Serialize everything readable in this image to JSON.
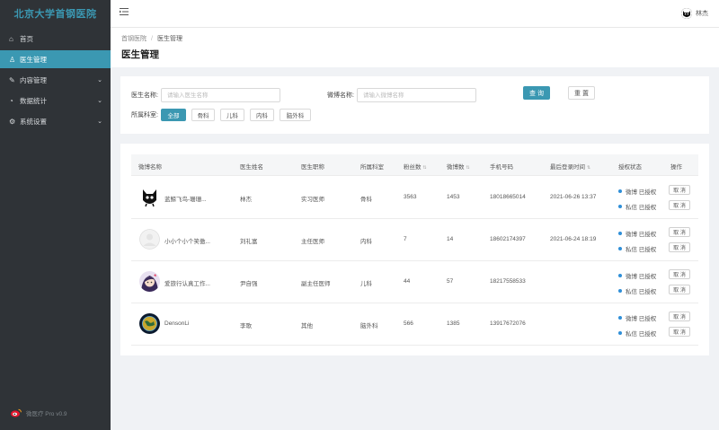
{
  "sidebar": {
    "brand": "北京大学首钢医院",
    "items": [
      {
        "label": "首页",
        "icon": "home-icon",
        "glyph": "⌂",
        "has_children": false,
        "active": false
      },
      {
        "label": "医生管理",
        "icon": "user-icon",
        "glyph": "♙",
        "has_children": false,
        "active": true
      },
      {
        "label": "内容管理",
        "icon": "edit-icon",
        "glyph": "✎",
        "has_children": true,
        "active": false
      },
      {
        "label": "数据统计",
        "icon": "pie-chart-icon",
        "glyph": "◔",
        "has_children": true,
        "active": false
      },
      {
        "label": "系统设置",
        "icon": "gear-icon",
        "glyph": "⚙",
        "has_children": true,
        "active": false
      }
    ],
    "footer": "微医疗 Pro v0.9"
  },
  "header": {
    "menu_icon": "menu-fold-icon",
    "user_name": "林杰"
  },
  "breadcrumb": [
    "首钢医院",
    "医生管理"
  ],
  "page_title": "医生管理",
  "filter": {
    "doctor_label": "医生名称:",
    "doctor_placeholder": "请输入医生名称",
    "weibo_label": "微博名称:",
    "weibo_placeholder": "请输入微博名称",
    "query_label": "查 询",
    "reset_label": "重 置",
    "dept_label": "所属科室:",
    "departments": [
      {
        "label": "全部",
        "active": true
      },
      {
        "label": "骨科",
        "active": false
      },
      {
        "label": "儿科",
        "active": false
      },
      {
        "label": "内科",
        "active": false
      },
      {
        "label": "脑外科",
        "active": false
      }
    ]
  },
  "table": {
    "columns": [
      "微博名称",
      "医生姓名",
      "医生职称",
      "所属科室",
      "粉丝数",
      "微博数",
      "手机号码",
      "最后登录时间",
      "授权状态",
      "操作"
    ],
    "auth_labels": [
      "微博 已授权",
      "私信 已授权"
    ],
    "action_label": "取 消",
    "rows": [
      {
        "weibo": "蓝鲸飞鸟-珊珊...",
        "name": "林杰",
        "title": "实习医师",
        "dept": "骨科",
        "fans": "3563",
        "posts": "1453",
        "phone": "18018665014",
        "last_login": "2021-06-26 13:37",
        "avatar": "black-cat-avatar"
      },
      {
        "weibo": "小小个小个笑傲...",
        "name": "刘礼富",
        "title": "主任医师",
        "dept": "内科",
        "fans": "7",
        "posts": "14",
        "phone": "18602174397",
        "last_login": "2021-06-24 18:19",
        "avatar": "default-avatar"
      },
      {
        "weibo": "爱旅行认真工作...",
        "name": "尹自强",
        "title": "副主任医师",
        "dept": "儿科",
        "fans": "44",
        "posts": "57",
        "phone": "18217558533",
        "last_login": "",
        "avatar": "cartoon-girl-avatar"
      },
      {
        "weibo": "DensonLi",
        "name": "李歌",
        "title": "其他",
        "dept": "脑外科",
        "fans": "566",
        "posts": "1385",
        "phone": "13917672076",
        "last_login": "",
        "avatar": "globe-avatar"
      }
    ]
  },
  "colors": {
    "accent": "#3b98b2",
    "sidebar_bg": "#2f3337",
    "auth_dot": "#2f8fd8"
  }
}
